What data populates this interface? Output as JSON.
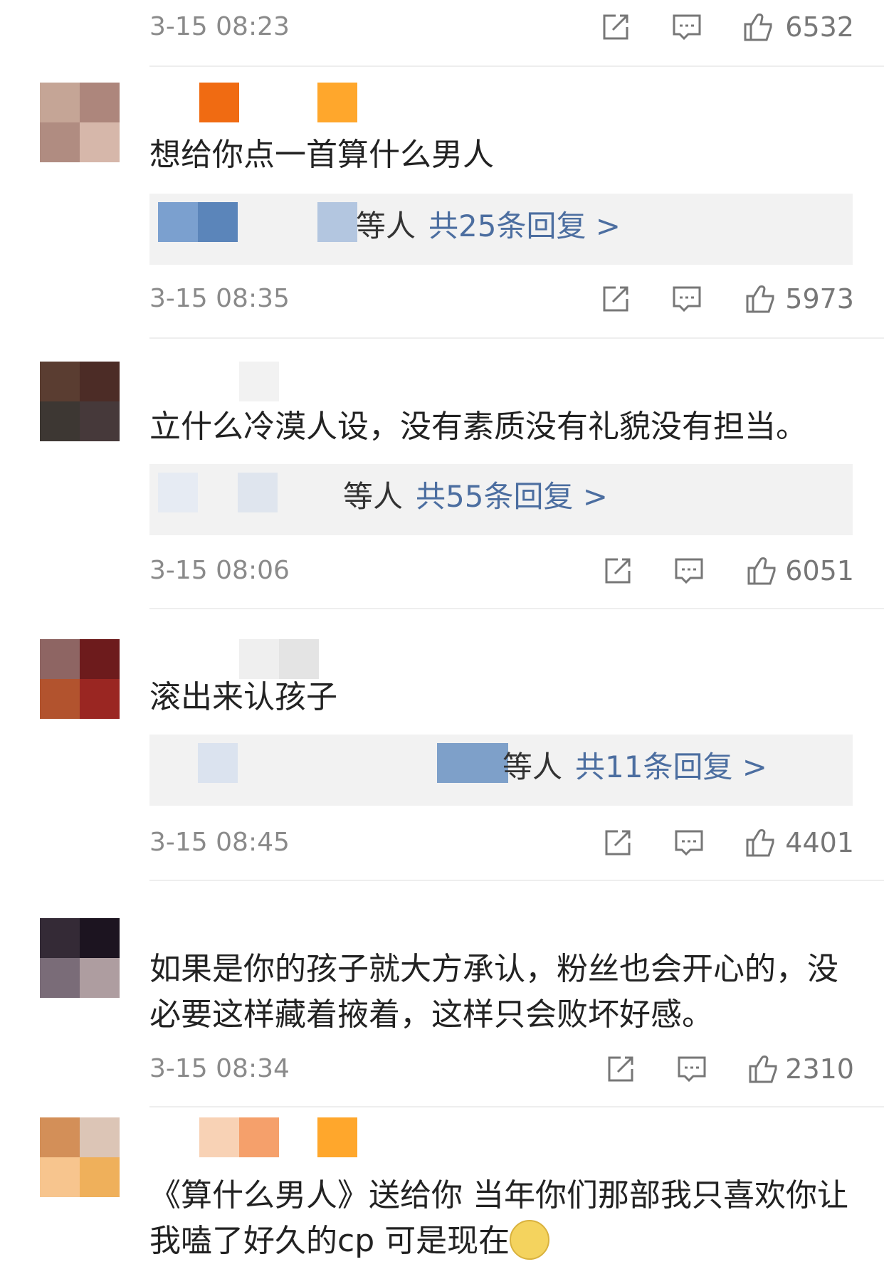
{
  "comments": [
    {
      "time": "3-15 08:23",
      "likes": "6532",
      "avatar_colors": [],
      "content": ""
    },
    {
      "avatar_colors": [
        "#c5a596",
        "#ad867c",
        "#b08c81",
        "#d6b7aa"
      ],
      "name_colors": [
        "#f06b12",
        "#ffa72c"
      ],
      "content": "想给你点一首算什么男人",
      "reply_who": "等人",
      "reply_count": "共25条回复 >",
      "reply_blur_colors": [
        "#7ba0cf",
        "#5b85ba",
        "#b3c6e0"
      ],
      "time": "3-15 08:35",
      "likes": "5973"
    },
    {
      "avatar_colors": [
        "#5a3d31",
        "#4c2c26",
        "#3d3733",
        "#46393a"
      ],
      "name_colors": [],
      "content": "立什么冷漠人设，没有素质没有礼貌没有担当。",
      "reply_who": "等人",
      "reply_count": "共55条回复 >",
      "reply_blur_colors": [
        "#e6ebf3",
        "#dfe5ee"
      ],
      "time": "3-15 08:06",
      "likes": "6051"
    },
    {
      "avatar_colors": [
        "#8e6563",
        "#6d1b1c",
        "#b2532e",
        "#9a2622"
      ],
      "name_colors": [
        "#efefef",
        "#e4e4e4"
      ],
      "content": "滚出来认孩子",
      "reply_who": "等人",
      "reply_count": "共11条回复 >",
      "reply_blur_colors": [
        "#dbe3ef",
        "#7ea0c9"
      ],
      "time": "3-15 08:45",
      "likes": "4401"
    },
    {
      "avatar_colors": [
        "#342a36",
        "#1c1420",
        "#7a6c78",
        "#ae9da0"
      ],
      "name_colors": [],
      "content": "如果是你的孩子就大方承认，粉丝也会开心的，没必要这样藏着掖着，这样只会败坏好感。",
      "time": "3-15 08:34",
      "likes": "2310"
    },
    {
      "avatar_colors": [
        "#d38f58",
        "#dcc5b6",
        "#f7c58e",
        "#efb05b"
      ],
      "name_colors": [
        "#f8d2b5",
        "#f5a06b",
        "#ffa72c"
      ],
      "content": "《算什么男人》送给你 当年你们那部我只喜欢你让我嗑了好久的cp 可是现在",
      "emoji_icon": "dizzy-face-emoji"
    }
  ],
  "icons": {
    "repost": "share-icon",
    "comment": "comment-icon",
    "like": "thumbs-up-icon"
  }
}
